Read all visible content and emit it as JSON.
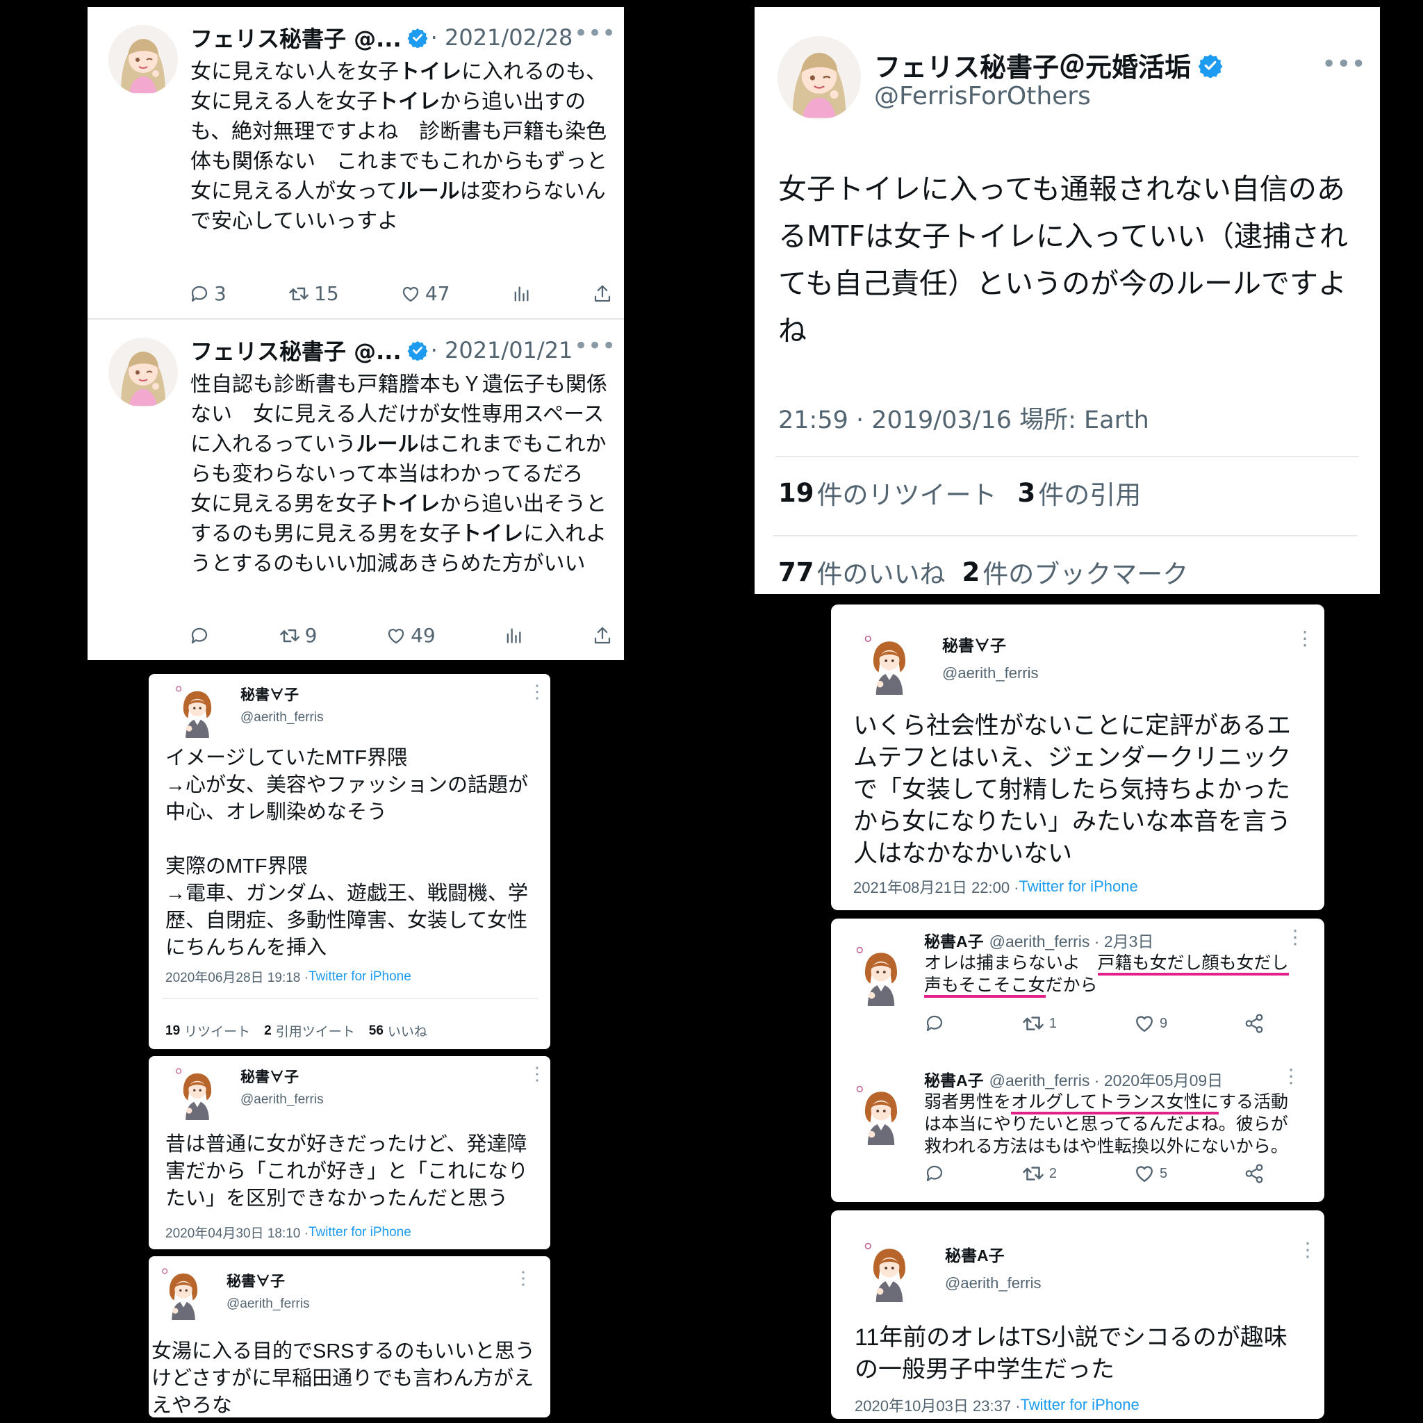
{
  "tw1": {
    "t1": {
      "name": "フェリス秘書子 @...",
      "date": "· 2021/02/28",
      "body_parts": [
        {
          "t": "女に見えない人を女子",
          "b": false
        },
        {
          "t": "トイレ",
          "b": true
        },
        {
          "t": "に入れるのも、女に見える人を女子",
          "b": false
        },
        {
          "t": "トイレ",
          "b": true
        },
        {
          "t": "から追い出すのも、絶対無理ですよね　診断書も戸籍も染色体も関係ない　これまでもこれからもずっと女に見える人が女って",
          "b": false
        },
        {
          "t": "ルール",
          "b": true
        },
        {
          "t": "は変わらないんで安心していいっすよ",
          "b": false
        }
      ],
      "replies": "3",
      "retweets": "15",
      "likes": "47"
    },
    "t2": {
      "name": "フェリス秘書子 @...",
      "date": "· 2021/01/21",
      "body_parts": [
        {
          "t": "性自認も診断書も戸籍謄本もＹ遺伝子も関係ない　女に見える人だけが女性専用スペースに入れるっていう",
          "b": false
        },
        {
          "t": "ルール",
          "b": true
        },
        {
          "t": "はこれまでもこれからも変わらないって本当はわかってるだろ　女に見える男を女子",
          "b": false
        },
        {
          "t": "トイレ",
          "b": true
        },
        {
          "t": "から追い出そうとするのも男に見える男を女子",
          "b": false
        },
        {
          "t": "トイレ",
          "b": true
        },
        {
          "t": "に入れようとするのもいい加減あきらめた方がいい",
          "b": false
        }
      ],
      "retweets": "9",
      "likes": "49"
    }
  },
  "tw2": {
    "name": "フェリス秘書子＠元婚活垢",
    "handle": "@FerrisForOthers",
    "body": "女子トイレに入っても通報されない自信のあるMTFは女子トイレに入っていい（逮捕されても自己責任）というのが今のルールですよね",
    "meta": "21:59 · 2019/03/16 場所: Earth",
    "retweets_num": "19",
    "retweets_label": "件のリツイート",
    "quotes_num": "3",
    "quotes_label": "件の引用",
    "likes_num": "77",
    "likes_label": "件のいいね",
    "bookmarks_num": "2",
    "bookmarks_label": "件のブックマーク"
  },
  "tw3": {
    "name": "秘書∀子",
    "handle": "@aerith_ferris",
    "body": "イメージしていたMTF界隈\n→心が女、美容やファッションの話題が中心、オレ馴染めなそう\n\n実際のMTF界隈\n→電車、ガンダム、遊戯王、戦闘機、学歴、自閉症、多動性障害、女装して女性にちんちんを挿入",
    "date": "2020年06月28日 19:18 · ",
    "source": "Twitter for iPhone",
    "rt_num": "19",
    "rt_label": "リツイート",
    "qt_num": "2",
    "qt_label": "引用ツイート",
    "like_num": "56",
    "like_label": "いいね"
  },
  "tw4": {
    "name": "秘書∀子",
    "handle": "@aerith_ferris",
    "body": "昔は普通に女が好きだったけど、発達障害だから「これが好き」と「これになりたい」を区別できなかったんだと思う",
    "date": "2020年04月30日 18:10 · ",
    "source": "Twitter for iPhone"
  },
  "tw5": {
    "name": "秘書∀子",
    "handle": "@aerith_ferris",
    "body": "女湯に入る目的でSRSするのもいいと思うけどさすがに早稲田通りでも言わん方がええやろな"
  },
  "tw6": {
    "name": "秘書∀子",
    "handle": "@aerith_ferris",
    "body": "いくら社会性がないことに定評があるエムテフとはいえ、ジェンダークリニックで「女装して射精したら気持ちよかったから女になりたい」みたいな本音を言う人はなかなかいない",
    "date": "2021年08月21日 22:00 · ",
    "source": "Twitter for iPhone"
  },
  "tw7": {
    "t1": {
      "name": "秘書A子",
      "handle_date": "@aerith_ferris · 2月3日",
      "body_pre": "オレは捕まらないよ　",
      "body_u1": "戸籍も女だし顔も女だし",
      "body_u2": "声もそこそこ女",
      "body_post": "だから",
      "retweets": "1",
      "likes": "9"
    },
    "t2": {
      "name": "秘書A子",
      "handle_date": "@aerith_ferris · 2020年05月09日",
      "body_pre": "弱者男性を",
      "body_u": "オルグしてトランス女性に",
      "body_post": "する活動は本当にやりたいと思ってるんだよね。彼らが救われる方法はもはや性転換以外にないから。",
      "retweets": "2",
      "likes": "5"
    }
  },
  "tw8": {
    "name": "秘書A子",
    "handle": "@aerith_ferris",
    "body": "11年前のオレはTS小説でシコるのが趣味の一般男子中学生だった",
    "date": "2020年10月03日 23:37 · ",
    "source": "Twitter for iPhone"
  }
}
